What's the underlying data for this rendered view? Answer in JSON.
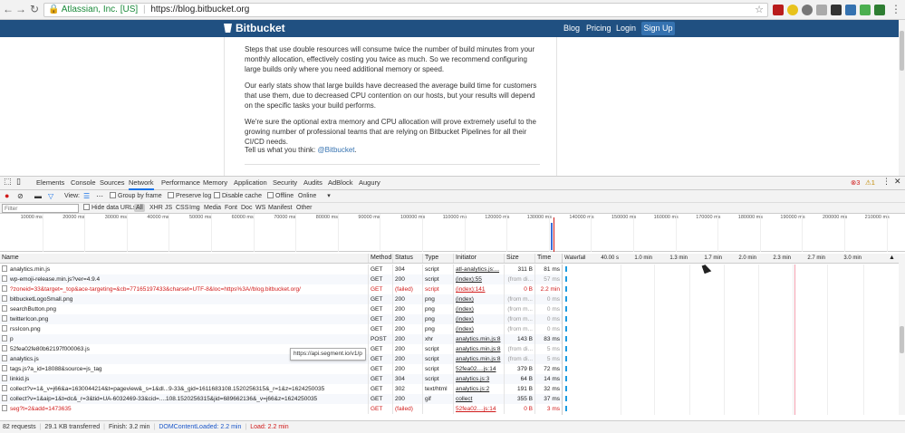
{
  "browser": {
    "security_org": "Atlassian, Inc. [US]",
    "url": "https://blog.bitbucket.org"
  },
  "site": {
    "brand": "Bitbucket",
    "nav": [
      "Blog",
      "Pricing",
      "Login"
    ],
    "signup": "Sign Up"
  },
  "article": {
    "p1": "Steps that use double resources will consume twice the number of build minutes from your monthly allocation, effectively costing you twice as much. So we recommend configuring large builds only where you need additional memory or speed.",
    "p2": "Our early stats show that large builds have decreased the average build time for customers that use them, due to decreased CPU contention on our hosts, but your results will depend on the specific tasks your build performs.",
    "p3": "We're sure the optional extra memory and CPU allocation will prove extremely useful to the growing number of professional teams that are relying on Bitbucket Pipelines for all their CI/CD needs.",
    "p4_prefix": "Tell us what you think: ",
    "p4_link": "@Bitbucket",
    "p4_suffix": "."
  },
  "devtools": {
    "tabs": [
      "Elements",
      "Console",
      "Sources",
      "Network",
      "Performance",
      "Memory",
      "Application",
      "Security",
      "Audits",
      "AdBlock",
      "Augury"
    ],
    "active_tab": "Network",
    "errors": "3",
    "warnings": "1",
    "toolbar": {
      "view_label": "View:",
      "group_by_frame": "Group by frame",
      "preserve_log": "Preserve log",
      "disable_cache": "Disable cache",
      "offline": "Offline",
      "throttle": "Online"
    },
    "filter": {
      "placeholder": "Filter",
      "hide_data_urls": "Hide data URLs",
      "types": [
        "All",
        "XHR",
        "JS",
        "CSS",
        "Img",
        "Media",
        "Font",
        "Doc",
        "WS",
        "Manifest",
        "Other"
      ]
    },
    "overview_ticks": [
      "10000 ms",
      "20000 ms",
      "30000 ms",
      "40000 ms",
      "50000 ms",
      "60000 ms",
      "70000 ms",
      "80000 ms",
      "90000 ms",
      "100000 ms",
      "110000 ms",
      "120000 ms",
      "130000 ms",
      "140000 ms",
      "150000 ms",
      "160000 ms",
      "170000 ms",
      "180000 ms",
      "190000 ms",
      "200000 ms",
      "210000 ms"
    ],
    "columns": {
      "name": "Name",
      "method": "Method",
      "status": "Status",
      "type": "Type",
      "initiator": "Initiator",
      "size": "Size",
      "time": "Time",
      "waterfall": "Waterfall"
    },
    "waterfall_ticks": [
      "40.00 s",
      "1.0 min",
      "1.3 min",
      "1.7 min",
      "2.0 min",
      "2.3 min",
      "2.7 min",
      "3.0 min"
    ],
    "rows": [
      {
        "name": "analytics.min.js",
        "method": "GET",
        "status": "304",
        "type": "script",
        "initiator": "atl-analytics.js:...",
        "size": "311 B",
        "time": "81 ms",
        "error": false
      },
      {
        "name": "wp-emoji-release.min.js?ver=4.9.4",
        "method": "GET",
        "status": "200",
        "type": "script",
        "initiator": "(index):55",
        "size": "(from di...",
        "time": "57 ms",
        "error": false
      },
      {
        "name": "?zoneid=33&target=_top&ace-targeting=&cb=77165197433&charset=UTF-8&loc=https%3A//blog.bitbucket.org/",
        "method": "GET",
        "status": "(failed)",
        "type": "script",
        "initiator": "(index):141",
        "size": "0 B",
        "time": "2.2 min",
        "error": true
      },
      {
        "name": "bitbucketLogoSmall.png",
        "method": "GET",
        "status": "200",
        "type": "png",
        "initiator": "(index)",
        "size": "(from m...",
        "time": "0 ms",
        "error": false
      },
      {
        "name": "searchButton.png",
        "method": "GET",
        "status": "200",
        "type": "png",
        "initiator": "(index)",
        "size": "(from m...",
        "time": "0 ms",
        "error": false
      },
      {
        "name": "twitterIcon.png",
        "method": "GET",
        "status": "200",
        "type": "png",
        "initiator": "(index)",
        "size": "(from m...",
        "time": "0 ms",
        "error": false
      },
      {
        "name": "rssIcon.png",
        "method": "GET",
        "status": "200",
        "type": "png",
        "initiator": "(index)",
        "size": "(from m...",
        "time": "0 ms",
        "error": false
      },
      {
        "name": "p",
        "method": "POST",
        "status": "200",
        "type": "xhr",
        "initiator": "analytics.min.js:8",
        "size": "143 B",
        "time": "83 ms",
        "error": false
      },
      {
        "name": "52fea02fe80b62197f000063.js",
        "method": "GET",
        "status": "200",
        "type": "script",
        "initiator": "analytics.min.js:8",
        "size": "(from di...",
        "time": "5 ms",
        "error": false
      },
      {
        "name": "analytics.js",
        "method": "GET",
        "status": "200",
        "type": "script",
        "initiator": "analytics.min.js:8",
        "size": "(from di...",
        "time": "5 ms",
        "error": false
      },
      {
        "name": "tags.js?a_id=18088&source=js_tag",
        "method": "GET",
        "status": "200",
        "type": "script",
        "initiator": "52fea02....js:14",
        "size": "379 B",
        "time": "72 ms",
        "error": false
      },
      {
        "name": "linkid.js",
        "method": "GET",
        "status": "304",
        "type": "script",
        "initiator": "analytics.js:3",
        "size": "64 B",
        "time": "14 ms",
        "error": false
      },
      {
        "name": "collect?v=1&_v=j66&a=1630044214&t=pageview&_s=1&dl...9-33&_gid=1611683108.1520256315&_r=1&z=1624250035",
        "method": "GET",
        "status": "302",
        "type": "text/html",
        "initiator": "analytics.js:2",
        "size": "191 B",
        "time": "32 ms",
        "error": false
      },
      {
        "name": "collect?v=1&aip=1&t=dc&_r=3&tid=UA-6032469-33&cid=....108.1520256315&jid=689662136&_v=j66&z=1624250035",
        "method": "GET",
        "status": "200",
        "type": "gif",
        "initiator": "collect",
        "size": "355 B",
        "time": "37 ms",
        "error": false
      },
      {
        "name": "seg?t=2&add=1473635",
        "method": "GET",
        "status": "(failed)",
        "type": "",
        "initiator": "52fea02....js:14",
        "size": "0 B",
        "time": "3 ms",
        "error": true
      }
    ],
    "tooltip": "https://api.segment.io/v1/p",
    "status": {
      "requests": "82 requests",
      "transferred": "29.1 KB transferred",
      "finish": "Finish: 3.2 min",
      "dcl": "DOMContentLoaded: 2.2 min",
      "load": "Load: 2.2 min"
    }
  },
  "colors": {
    "header": "#205081",
    "accent": "#1a73e8",
    "error": "#d01a1a"
  }
}
